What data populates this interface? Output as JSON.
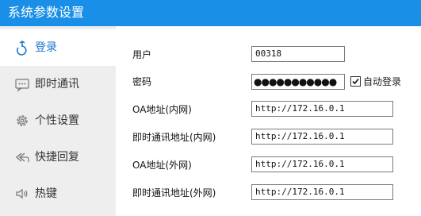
{
  "window": {
    "title": "系统参数设置"
  },
  "sidebar": {
    "items": [
      {
        "label": "登录",
        "icon": "login-icon",
        "active": true
      },
      {
        "label": "即时通讯",
        "icon": "chat-icon",
        "active": false
      },
      {
        "label": "个性设置",
        "icon": "gear-icon",
        "active": false
      },
      {
        "label": "快捷回复",
        "icon": "reply-icon",
        "active": false
      },
      {
        "label": "热键",
        "icon": "speaker-icon",
        "active": false
      }
    ]
  },
  "form": {
    "username": {
      "label": "用户",
      "value": "00318"
    },
    "password": {
      "label": "密码",
      "value": "●●●●●●●●●●●"
    },
    "auto_login": {
      "label": "自动登录",
      "checked": true
    },
    "oa_internal": {
      "label": "OA地址(内网)",
      "value": "http://172.16.0.1"
    },
    "im_internal": {
      "label": "即时通讯地址(内网)",
      "value": "http://172.16.0.1"
    },
    "oa_external": {
      "label": "OA地址(外网)",
      "value": "http://172.16.0.1"
    },
    "im_external": {
      "label": "即时通讯地址(外网)",
      "value": "http://172.16.0.1"
    }
  },
  "colors": {
    "accent": "#1a8fe8",
    "sidebar_bg": "#eeeeee",
    "active_text": "#1a76cf"
  }
}
